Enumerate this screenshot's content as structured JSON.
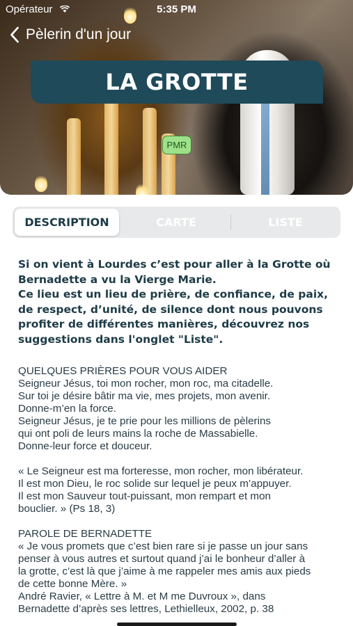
{
  "status_bar": {
    "carrier": "Opérateur",
    "time": "5:35 PM"
  },
  "nav": {
    "back_label": "Pèlerin d'un jour"
  },
  "header": {
    "title": "LA GROTTE",
    "badge": "PMR"
  },
  "tabs": [
    {
      "label": "DESCRIPTION",
      "active": true
    },
    {
      "label": "CARTE",
      "active": false
    },
    {
      "label": "LISTE",
      "active": false
    }
  ],
  "description": {
    "intro": "Si on vient à Lourdes c’est pour aller à la Grotte où Bernadette a vu la Vierge Marie.\nCe lieu est un lieu de prière, de confiance, de paix, de respect, d’unité, de silence dont nous pouvons profiter de différentes manières, découvrez nos suggestions dans l'onglet \"Liste\".",
    "prayers_heading": "QUELQUES PRIÈRES POUR VOUS AIDER",
    "prayers_text": "Seigneur Jésus, toi mon rocher, mon roc, ma citadelle.\nSur toi je désire bâtir ma vie, mes projets, mon avenir.\nDonne-m’en la force.\nSeigneur Jésus, je te prie pour les millions de pèlerins\nqui ont poli de leurs mains la roche de Massabielle.\nDonne-leur force et douceur.",
    "psalm_text": "« Le Seigneur est ma forteresse, mon rocher, mon libérateur.\nIl est mon Dieu, le roc solide sur lequel je peux m’appuyer.\nIl est mon Sauveur tout-puissant, mon rempart et mon\nbouclier. » (Ps 18, 3)",
    "bernadette_heading": "PAROLE DE BERNADETTE",
    "bernadette_text": "« Je vous promets que c’est bien rare si je passe un jour sans\npenser à vous autres et surtout quand j’ai le bonheur d’aller à\nla grotte, c’est là que j’aime à me rappeler mes amis aux pieds\nde cette bonne Mère. »\nAndré Ravier, « Lettre à M. et M me Duvroux », dans\nBernadette d’après ses lettres, Lethielleux, 2002, p. 38"
  }
}
